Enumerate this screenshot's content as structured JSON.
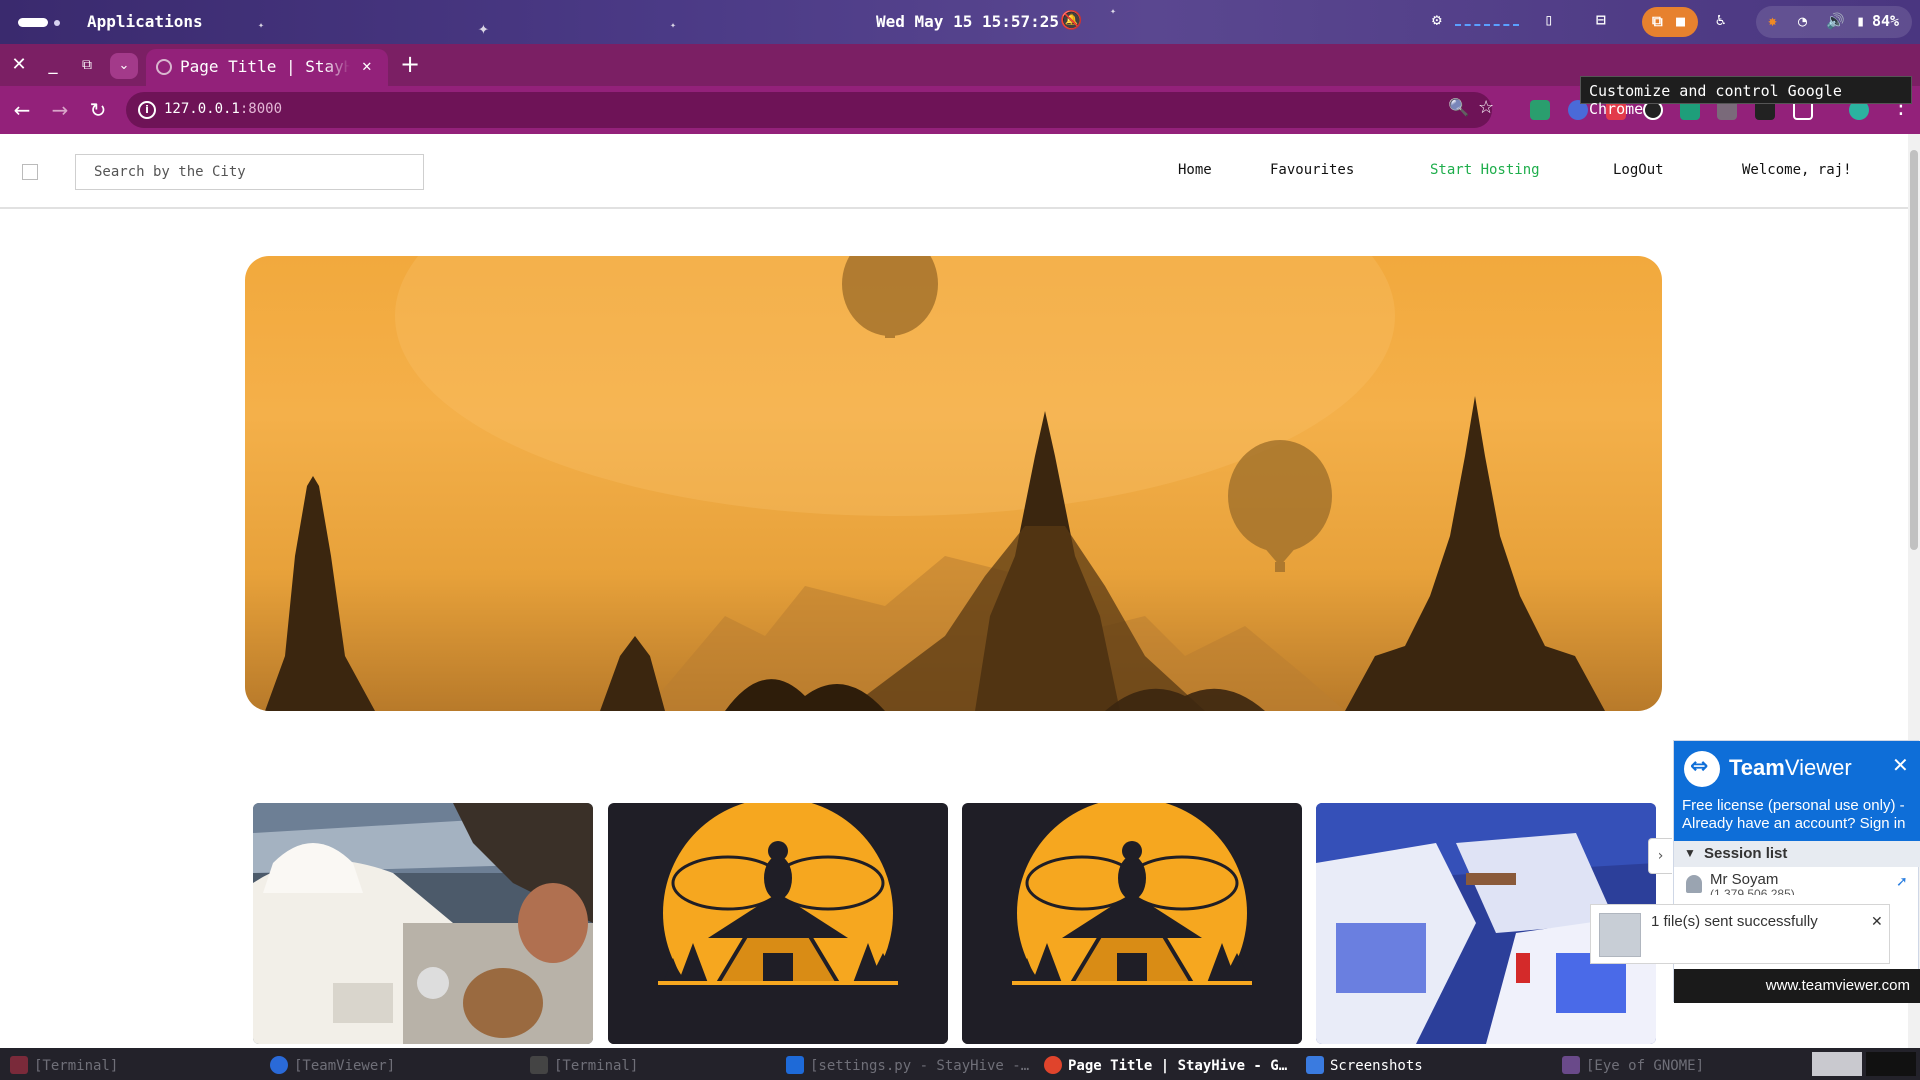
{
  "topbar": {
    "apps_label": "Applications",
    "clock": "Wed May 15 15:57:25",
    "battery": "84%"
  },
  "browser": {
    "tab_title": "Page Title | StayHive",
    "url_host": "127.0.0.1",
    "url_port": ":8000",
    "tooltip": "Customize and control Google Chrome"
  },
  "site": {
    "search_placeholder": "Search by the City",
    "nav": {
      "home": "Home",
      "favourites": "Favourites",
      "start_hosting": "Start Hosting",
      "logout": "LogOut",
      "welcome": "Welcome, raj!"
    },
    "accent_color": "#1fae4c"
  },
  "teamviewer": {
    "brand_bold": "Team",
    "brand_light": "Viewer",
    "license_text": "Free license (personal use only) - Already have an account? Sign in",
    "session_list": "Session list",
    "user_name": "Mr Soyam",
    "user_id": "(1 379 506 285)",
    "toast": "1 file(s) sent successfully",
    "footer": "www.teamviewer.com"
  },
  "taskbar": {
    "items": [
      "[Terminal]",
      "[TeamViewer]",
      "[Terminal]",
      "[settings.py - StayHive -…",
      "Page Title | StayHive - G…",
      "Screenshots",
      "[Eye of GNOME]"
    ]
  }
}
